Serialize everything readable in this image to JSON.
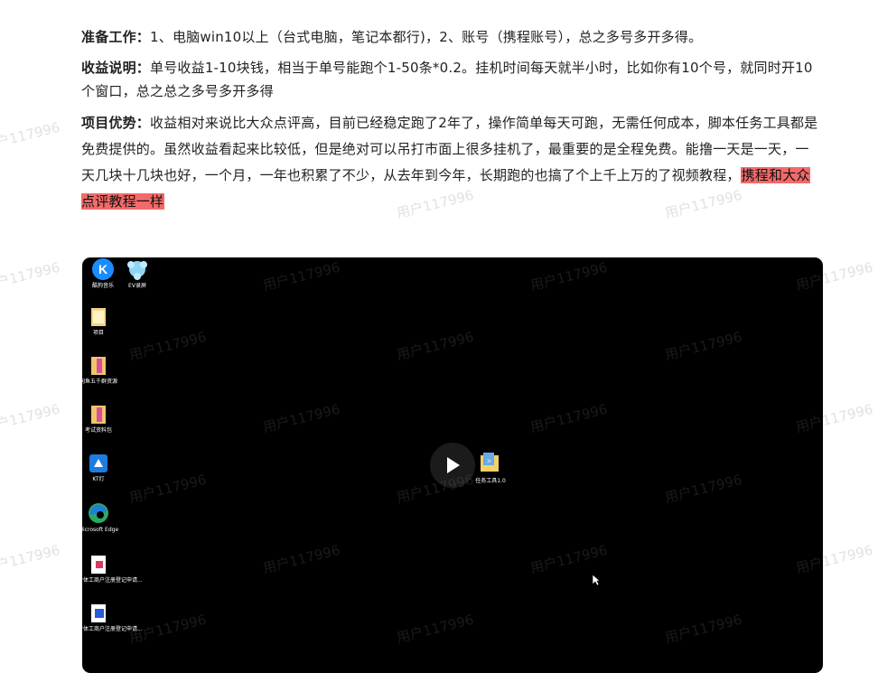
{
  "article": {
    "p1": {
      "label": "准备工作：",
      "text": "1、电脑win10以上（台式电脑，笔记本都行)，2、账号（携程账号），总之多号多开多得。"
    },
    "p2": {
      "label": "收益说明：",
      "text": "单号收益1-10块钱，相当于单号能跑个1-50条*0.2。挂机时间每天就半小时，比如你有10个号，就同时开10个窗口，总之总之多号多开多得"
    },
    "p3": {
      "label": "项目优势：",
      "text": "收益相对来说比大众点评高，目前已经稳定跑了2年了，操作简单每天可跑，无需任何成本，脚本任务工具都是免费提供的。虽然收益看起来比较低，但是绝对可以吊打市面上很多挂机了，最重要的是全程免费。能撸一天是一天，一天几块十几块也好，一个月，一年也积累了不少，从去年到今年，长期跑的也搞了个上千上万的了视频教程，",
      "highlight": "携程和大众点评教程一样"
    }
  },
  "video": {
    "desktop_icons": [
      {
        "label": "酷狗音乐",
        "icon": "kugou-icon"
      },
      {
        "label": "EV录屏",
        "icon": "ev-recorder-icon"
      },
      {
        "label": "项目",
        "icon": "folder-icon"
      },
      {
        "label": "闲鱼五千群资源",
        "icon": "archive-icon"
      },
      {
        "label": "考试资料包",
        "icon": "archive-icon"
      },
      {
        "label": "KT灯",
        "icon": "app-shortcut-icon"
      },
      {
        "label": "Microsoft Edge",
        "icon": "edge-icon"
      },
      {
        "label": "个体工商户注册登记申请...",
        "icon": "wps-pdf-icon"
      },
      {
        "label": "个体工商户注册登记申请...",
        "icon": "word-doc-icon"
      },
      {
        "label": "任务工具1.0",
        "icon": "task-tool-icon"
      }
    ],
    "play_icon": "play-icon"
  },
  "watermark": "用户117996",
  "colors": {
    "highlight": "#f36a6a",
    "video_bg": "#000000"
  }
}
